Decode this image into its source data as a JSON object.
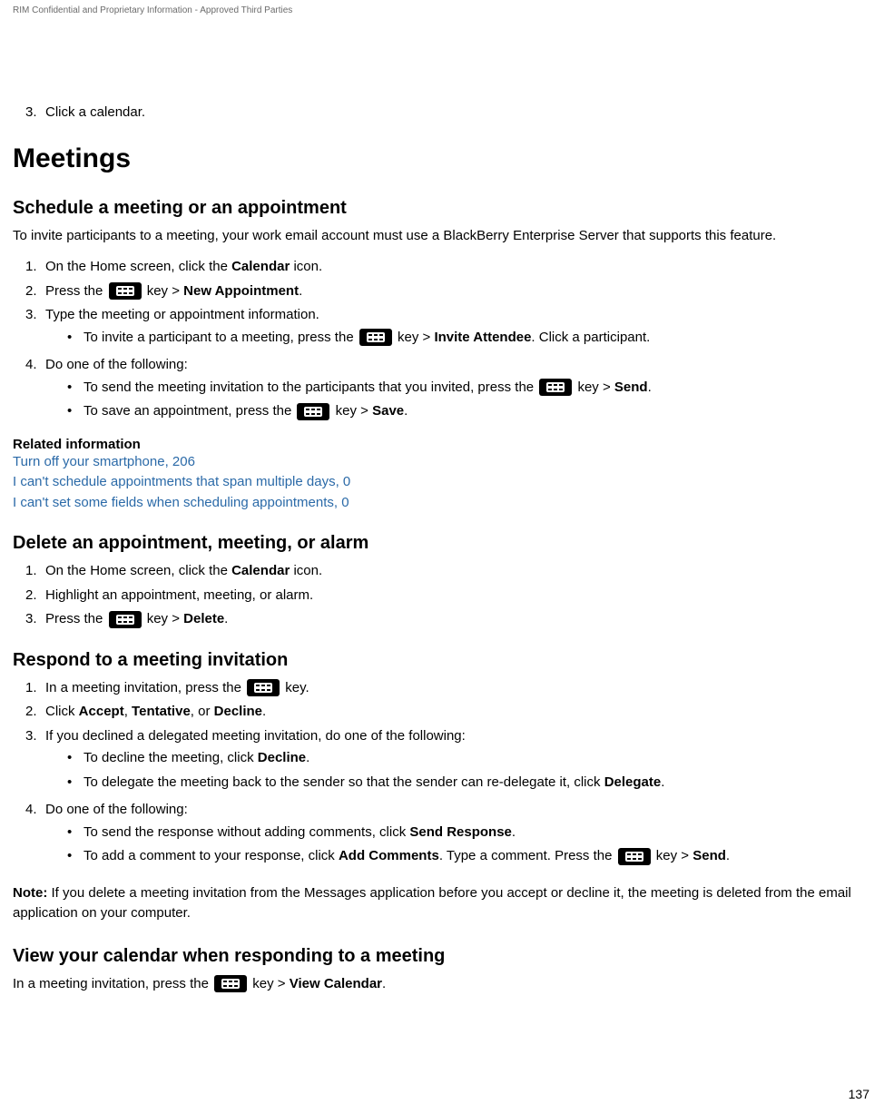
{
  "header": {
    "confidential": "RIM Confidential and Proprietary Information - Approved Third Parties"
  },
  "topStep": {
    "num": "3.",
    "text": "Click a calendar."
  },
  "h1": "Meetings",
  "schedule": {
    "heading": "Schedule a meeting or an appointment",
    "intro": "To invite participants to a meeting, your work email account must use a BlackBerry Enterprise Server that supports this feature.",
    "step1": {
      "num": "1.",
      "prefix": "On the Home screen, click the ",
      "bold1": "Calendar",
      "suffix": " icon."
    },
    "step2": {
      "num": "2.",
      "prefix": "Press the ",
      "mid1": " key > ",
      "bold1": "New Appointment",
      "suffix": "."
    },
    "step3": {
      "num": "3.",
      "text": "Type the meeting or appointment information."
    },
    "step3b1": {
      "prefix": "To invite a participant to a meeting, press the ",
      "mid1": " key > ",
      "bold1": "Invite Attendee",
      "suffix": ". Click a participant."
    },
    "step4": {
      "num": "4.",
      "text": "Do one of the following:"
    },
    "step4b1": {
      "prefix": "To send the meeting invitation to the participants that you invited, press the ",
      "mid1": " key > ",
      "bold1": "Send",
      "suffix": "."
    },
    "step4b2": {
      "prefix": "To save an appointment, press the ",
      "mid1": " key > ",
      "bold1": "Save",
      "suffix": "."
    }
  },
  "related": {
    "heading": "Related information",
    "link1": "Turn off your smartphone, 206",
    "link2": "I can't schedule appointments that span multiple days,  0",
    "link3": "I can't set some fields when scheduling appointments,  0"
  },
  "deleteSection": {
    "heading": "Delete an appointment, meeting, or alarm",
    "step1": {
      "num": "1.",
      "prefix": "On the Home screen, click the ",
      "bold1": "Calendar",
      "suffix": " icon."
    },
    "step2": {
      "num": "2.",
      "text": "Highlight an appointment, meeting, or alarm."
    },
    "step3": {
      "num": "3.",
      "prefix": "Press the ",
      "mid1": " key > ",
      "bold1": "Delete",
      "suffix": "."
    }
  },
  "respond": {
    "heading": "Respond to a meeting invitation",
    "step1": {
      "num": "1.",
      "prefix": "In a meeting invitation, press the ",
      "suffix": " key."
    },
    "step2": {
      "num": "2.",
      "prefix": "Click ",
      "bold1": "Accept",
      "mid1": ", ",
      "bold2": "Tentative",
      "mid2": ", or ",
      "bold3": "Decline",
      "suffix": "."
    },
    "step3": {
      "num": "3.",
      "text": "If you declined a delegated meeting invitation, do one of the following:"
    },
    "step3b1": {
      "prefix": "To decline the meeting, click ",
      "bold1": "Decline",
      "suffix": "."
    },
    "step3b2": {
      "prefix": "To delegate the meeting back to the sender so that the sender can re-delegate it, click ",
      "bold1": "Delegate",
      "suffix": "."
    },
    "step4": {
      "num": "4.",
      "text": "Do one of the following:"
    },
    "step4b1": {
      "prefix": "To send the response without adding comments, click ",
      "bold1": "Send Response",
      "suffix": "."
    },
    "step4b2": {
      "prefix": "To add a comment to your response, click ",
      "bold1": "Add Comments",
      "mid1": ". Type a comment. Press the ",
      "mid2": " key > ",
      "bold2": "Send",
      "suffix": "."
    }
  },
  "note": {
    "boldPrefix": "Note: ",
    "text": "If you delete a meeting invitation from the Messages application before you accept or decline it, the meeting is deleted from the email application on your computer."
  },
  "viewCalendar": {
    "heading": "View your calendar when responding to a meeting",
    "prefix": "In a meeting invitation, press the ",
    "mid1": " key > ",
    "bold1": "View Calendar",
    "suffix": "."
  },
  "pageNumber": "137"
}
